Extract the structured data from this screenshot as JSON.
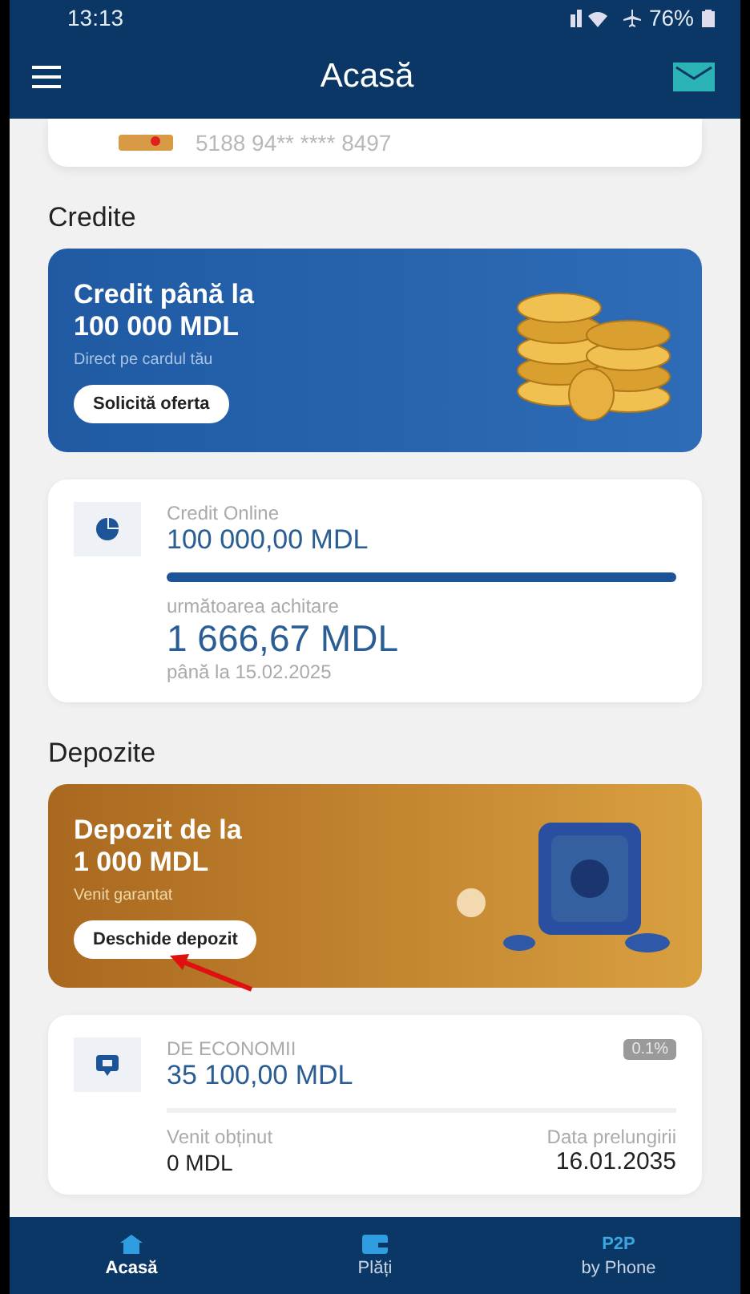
{
  "status_bar": {
    "time": "13:13",
    "battery": "76%"
  },
  "header": {
    "title": "Acasă"
  },
  "card": {
    "number": "5188 94** **** 8497"
  },
  "credits": {
    "heading": "Credite",
    "promo": {
      "title": "Credit până la\n100 000 MDL",
      "subtitle": "Direct pe cardul tău",
      "button": "Solicită oferta"
    },
    "loan": {
      "name": "Credit Online",
      "amount": "100 000,00 MDL",
      "level": 1,
      "next_label": "următoarea achitare",
      "next_amount": "1 666,67 MDL",
      "due": "până la 15.02.2025"
    }
  },
  "deposits": {
    "heading": "Depozite",
    "promo": {
      "title": "Depozit de la\n1 000 MDL",
      "subtitle": "Venit garantat",
      "button": "Deschide depozit"
    },
    "deposit": {
      "name": "DE ECONOMII",
      "rate": "0.1%",
      "amount": "35 100,00 MDL",
      "income_label": "Venit obținut",
      "income": "0 MDL",
      "date_label": "Data prelungirii",
      "date": "16.01.2035"
    }
  },
  "bottom_nav": [
    {
      "label": "Acasă",
      "kind": "home",
      "selected": true
    },
    {
      "label": "Plăți",
      "kind": "wallet",
      "selected": false
    },
    {
      "label": "by Phone",
      "top": "P2P",
      "kind": "text",
      "selected": false
    }
  ]
}
